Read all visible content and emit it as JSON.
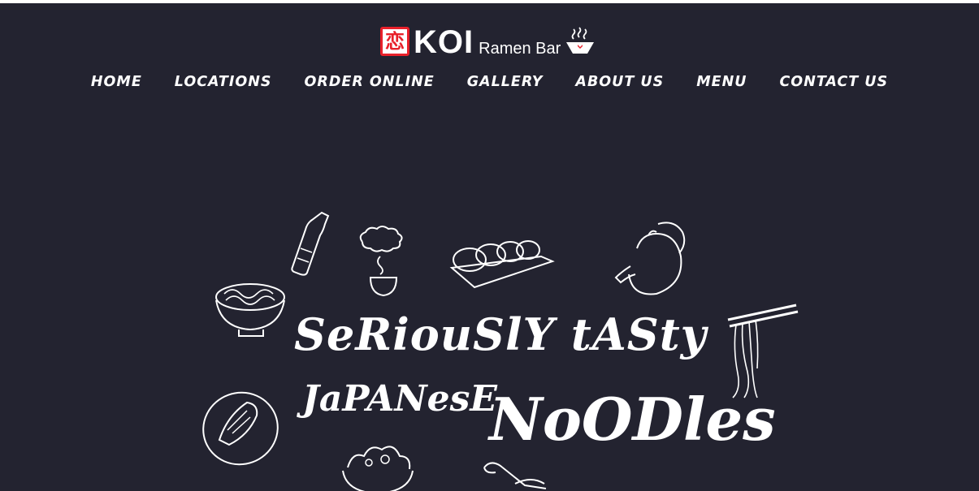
{
  "logo": {
    "kanji": "恋",
    "name": "KOI",
    "subtitle": "Ramen Bar",
    "accent_color": "#e8202a"
  },
  "nav": {
    "items": [
      {
        "label": "HOME"
      },
      {
        "label": "LOCATIONS"
      },
      {
        "label": "ORDER ONLINE"
      },
      {
        "label": "GALLERY"
      },
      {
        "label": "ABOUT US"
      },
      {
        "label": "MENU"
      },
      {
        "label": "CONTACT US"
      }
    ]
  },
  "hero": {
    "line1": "SeRiouSlY tASty",
    "line2": "JaPANesE",
    "line3": "NoODles",
    "doodles": [
      "sake-bottle-icon",
      "tea-cup-icon",
      "gyoza-icon",
      "teapot-icon",
      "noodle-bowl-icon",
      "chopsticks-noodles-icon",
      "dumpling-plate-icon",
      "salad-bowl-icon",
      "spoon-icon"
    ]
  },
  "colors": {
    "background": "#232330",
    "text": "#ffffff"
  }
}
